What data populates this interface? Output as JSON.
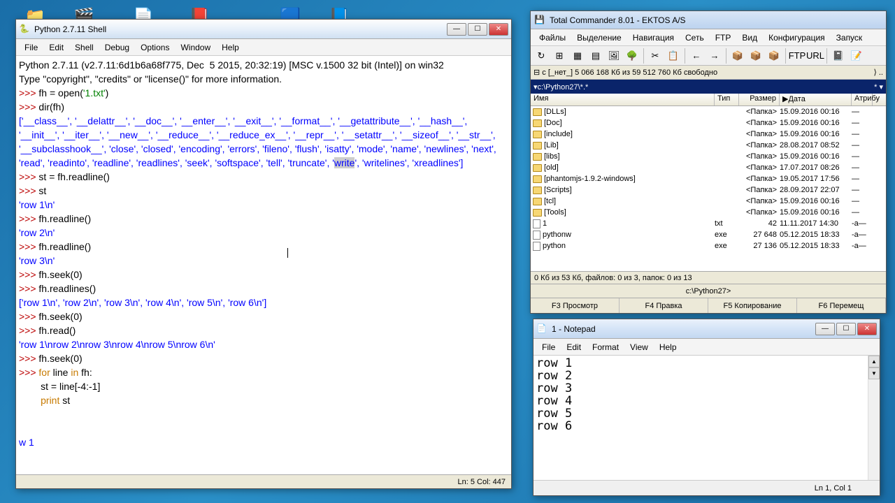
{
  "desktop_icons": [
    "📁",
    "🎬",
    "📄",
    "📕",
    "🟦",
    "📘"
  ],
  "python": {
    "title": "Python 2.7.11 Shell",
    "menu": [
      "File",
      "Edit",
      "Shell",
      "Debug",
      "Options",
      "Window",
      "Help"
    ],
    "status": "Ln: 5  Col: 447",
    "lines": [
      {
        "t": "Python 2.7.11 (v2.7.11:6d1b6a68f775, Dec  5 2015, 20:32:19) [MSC v.1500 32 bit (Intel)] on win32",
        "c": "black"
      },
      {
        "t": "Type \"copyright\", \"credits\" or \"license()\" for more information.",
        "c": "black"
      },
      {
        "seg": [
          {
            "t": ">>> ",
            "c": "red"
          },
          {
            "t": "fh = open(",
            "c": "black"
          },
          {
            "t": "'1.txt'",
            "c": "green"
          },
          {
            "t": ")",
            "c": "black"
          }
        ]
      },
      {
        "seg": [
          {
            "t": ">>> ",
            "c": "red"
          },
          {
            "t": "dir(fh)",
            "c": "black"
          }
        ]
      },
      {
        "t": "['__class__', '__delattr__', '__doc__', '__enter__', '__exit__', '__format__', '__getattribute__', '__hash__', '__init__', '__iter__', '__new__', '__reduce__', '__reduce_ex__', '__repr__', '__setattr__', '__sizeof__', '__str__', '__subclasshook__', 'close', 'closed', 'encoding', 'errors', 'fileno', 'flush', 'isatty', 'mode', 'name', 'newlines', 'next', 'read', 'readinto', 'readline', 'readlines', 'seek', 'softspace', 'tell', 'truncate', '",
        "c": "blue"
      },
      {
        "seg": [
          {
            "t": "write",
            "c": "blue",
            "sel": true
          },
          {
            "t": "', 'writelines', 'xreadlines']",
            "c": "blue"
          }
        ]
      },
      {
        "seg": [
          {
            "t": ">>> ",
            "c": "red"
          },
          {
            "t": "st = fh.readline()",
            "c": "black"
          }
        ]
      },
      {
        "seg": [
          {
            "t": ">>> ",
            "c": "red"
          },
          {
            "t": "st",
            "c": "black"
          }
        ]
      },
      {
        "t": "'row 1\\n'",
        "c": "blue"
      },
      {
        "seg": [
          {
            "t": ">>> ",
            "c": "red"
          },
          {
            "t": "fh.readline()",
            "c": "black"
          }
        ]
      },
      {
        "t": "'row 2\\n'",
        "c": "blue"
      },
      {
        "seg": [
          {
            "t": ">>> ",
            "c": "red"
          },
          {
            "t": "fh.readline()",
            "c": "black"
          }
        ]
      },
      {
        "t": "'row 3\\n'",
        "c": "blue"
      },
      {
        "seg": [
          {
            "t": ">>> ",
            "c": "red"
          },
          {
            "t": "fh.seek(",
            "c": "black"
          },
          {
            "t": "0",
            "c": "black"
          },
          {
            "t": ")",
            "c": "black"
          }
        ]
      },
      {
        "seg": [
          {
            "t": ">>> ",
            "c": "red"
          },
          {
            "t": "fh.readlines()",
            "c": "black"
          }
        ]
      },
      {
        "t": "['row 1\\n', 'row 2\\n', 'row 3\\n', 'row 4\\n', 'row 5\\n', 'row 6\\n']",
        "c": "blue"
      },
      {
        "seg": [
          {
            "t": ">>> ",
            "c": "red"
          },
          {
            "t": "fh.seek(",
            "c": "black"
          },
          {
            "t": "0",
            "c": "black"
          },
          {
            "t": ")",
            "c": "black"
          }
        ]
      },
      {
        "seg": [
          {
            "t": ">>> ",
            "c": "red"
          },
          {
            "t": "fh.read()",
            "c": "black"
          }
        ]
      },
      {
        "t": "'row 1\\nrow 2\\nrow 3\\nrow 4\\nrow 5\\nrow 6\\n'",
        "c": "blue"
      },
      {
        "seg": [
          {
            "t": ">>> ",
            "c": "red"
          },
          {
            "t": "fh.seek(",
            "c": "black"
          },
          {
            "t": "0",
            "c": "black"
          },
          {
            "t": ")",
            "c": "black"
          }
        ]
      },
      {
        "seg": [
          {
            "t": ">>> ",
            "c": "red"
          },
          {
            "t": "for ",
            "c": "orange"
          },
          {
            "t": "line ",
            "c": "black"
          },
          {
            "t": "in ",
            "c": "orange"
          },
          {
            "t": "fh:",
            "c": "black"
          }
        ]
      },
      {
        "seg": [
          {
            "t": "        st = line[",
            "c": "black"
          },
          {
            "t": "-4",
            "c": "black"
          },
          {
            "t": ":",
            "c": "black"
          },
          {
            "t": "-1",
            "c": "black"
          },
          {
            "t": "]",
            "c": "black"
          }
        ]
      },
      {
        "seg": [
          {
            "t": "        ",
            "c": "black"
          },
          {
            "t": "print ",
            "c": "orange"
          },
          {
            "t": "st",
            "c": "black"
          }
        ]
      },
      {
        "t": "",
        "c": "black"
      },
      {
        "t": "",
        "c": "black"
      },
      {
        "t": "w 1",
        "c": "blue"
      }
    ]
  },
  "tc": {
    "title": "Total Commander 8.01 - EKTOS A/S",
    "menu": [
      "Файлы",
      "Выделение",
      "Навигация",
      "Сеть",
      "FTP",
      "Вид",
      "Конфигурация",
      "Запуск"
    ],
    "toolbar": [
      "↻",
      "⊞",
      "▦",
      "▤",
      "🖼",
      "🌳",
      "|",
      "✂",
      "📋",
      "|",
      "←",
      "→",
      "|",
      "📦",
      "📦",
      "📦",
      "|",
      "FTP",
      "URL",
      "|",
      "📓",
      "📝"
    ],
    "drive": "⊟ c   [_нет_] 5 066 168 Кб из 59 512 760 Кб свободно",
    "path": "▾c:\\Python27\\*.*",
    "headers": [
      "Имя",
      "Тип",
      "Размер",
      "▶Дата",
      "Атрибу"
    ],
    "rows": [
      {
        "n": "[DLLs]",
        "folder": true,
        "s": "<Папка>",
        "d": "15.09.2016 00:16",
        "a": "—"
      },
      {
        "n": "[Doc]",
        "folder": true,
        "s": "<Папка>",
        "d": "15.09.2016 00:16",
        "a": "—"
      },
      {
        "n": "[include]",
        "folder": true,
        "s": "<Папка>",
        "d": "15.09.2016 00:16",
        "a": "—"
      },
      {
        "n": "[Lib]",
        "folder": true,
        "s": "<Папка>",
        "d": "28.08.2017 08:52",
        "a": "—"
      },
      {
        "n": "[libs]",
        "folder": true,
        "s": "<Папка>",
        "d": "15.09.2016 00:16",
        "a": "—"
      },
      {
        "n": "[old]",
        "folder": true,
        "s": "<Папка>",
        "d": "17.07.2017 08:26",
        "a": "—"
      },
      {
        "n": "[phantomjs-1.9.2-windows]",
        "folder": true,
        "s": "<Папка>",
        "d": "19.05.2017 17:56",
        "a": "—"
      },
      {
        "n": "[Scripts]",
        "folder": true,
        "s": "<Папка>",
        "d": "28.09.2017 22:07",
        "a": "—"
      },
      {
        "n": "[tcl]",
        "folder": true,
        "s": "<Папка>",
        "d": "15.09.2016 00:16",
        "a": "—"
      },
      {
        "n": "[Tools]",
        "folder": true,
        "s": "<Папка>",
        "d": "15.09.2016 00:16",
        "a": "—"
      },
      {
        "n": "1",
        "folder": false,
        "e": "txt",
        "s": "42",
        "d": "11.11.2017 14:30",
        "a": "-a—"
      },
      {
        "n": "pythonw",
        "folder": false,
        "e": "exe",
        "s": "27 648",
        "d": "05.12.2015 18:33",
        "a": "-a—"
      },
      {
        "n": "python",
        "folder": false,
        "e": "exe",
        "s": "27 136",
        "d": "05.12.2015 18:33",
        "a": "-a—"
      }
    ],
    "status": "0 Кб из 53 Кб, файлов: 0 из 3, папок: 0 из 13",
    "cmdline": "c:\\Python27>",
    "fkeys": [
      "F3 Просмотр",
      "F4 Правка",
      "F5 Копирование",
      "F6 Перемещ"
    ]
  },
  "notepad": {
    "title": "1 - Notepad",
    "menu": [
      "File",
      "Edit",
      "Format",
      "View",
      "Help"
    ],
    "text": "row 1\nrow 2\nrow 3\nrow 4\nrow 5\nrow 6",
    "status": "Ln 1, Col 1"
  }
}
